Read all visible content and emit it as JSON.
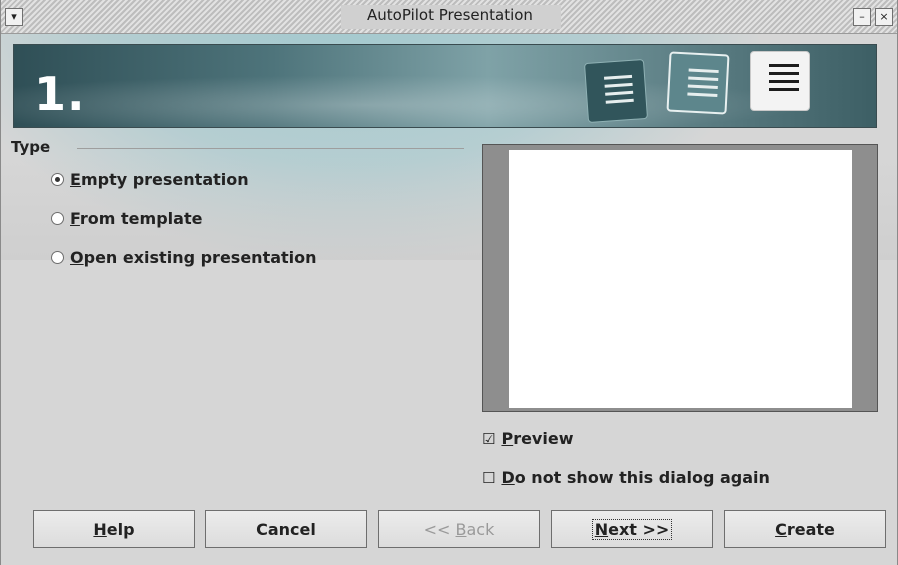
{
  "window": {
    "title": "AutoPilot Presentation",
    "menu_glyph": "▾",
    "minimize_glyph": "–",
    "close_glyph": "×"
  },
  "banner": {
    "step": "1."
  },
  "type_section": {
    "label": "Type",
    "options": [
      {
        "mnemonic": "E",
        "rest": "mpty presentation",
        "checked": true
      },
      {
        "mnemonic": "F",
        "rest": "rom template",
        "checked": false
      },
      {
        "mnemonic": "O",
        "rest": "pen existing presentation",
        "checked": false
      }
    ]
  },
  "preview": {
    "preview_check": {
      "mnemonic": "P",
      "rest": "review",
      "checked": true,
      "mark": "☑"
    },
    "dont_show_check": {
      "mnemonic": "D",
      "rest": "o not show this dialog again",
      "checked": false,
      "mark": "☐"
    }
  },
  "buttons": {
    "help": {
      "mnemonic": "H",
      "rest": "elp"
    },
    "cancel": {
      "label": "Cancel"
    },
    "back": {
      "prefix": "<< ",
      "mnemonic": "B",
      "rest": "ack"
    },
    "next": {
      "mnemonic": "N",
      "rest": "ext >>"
    },
    "create": {
      "mnemonic": "C",
      "rest": "reate"
    }
  }
}
